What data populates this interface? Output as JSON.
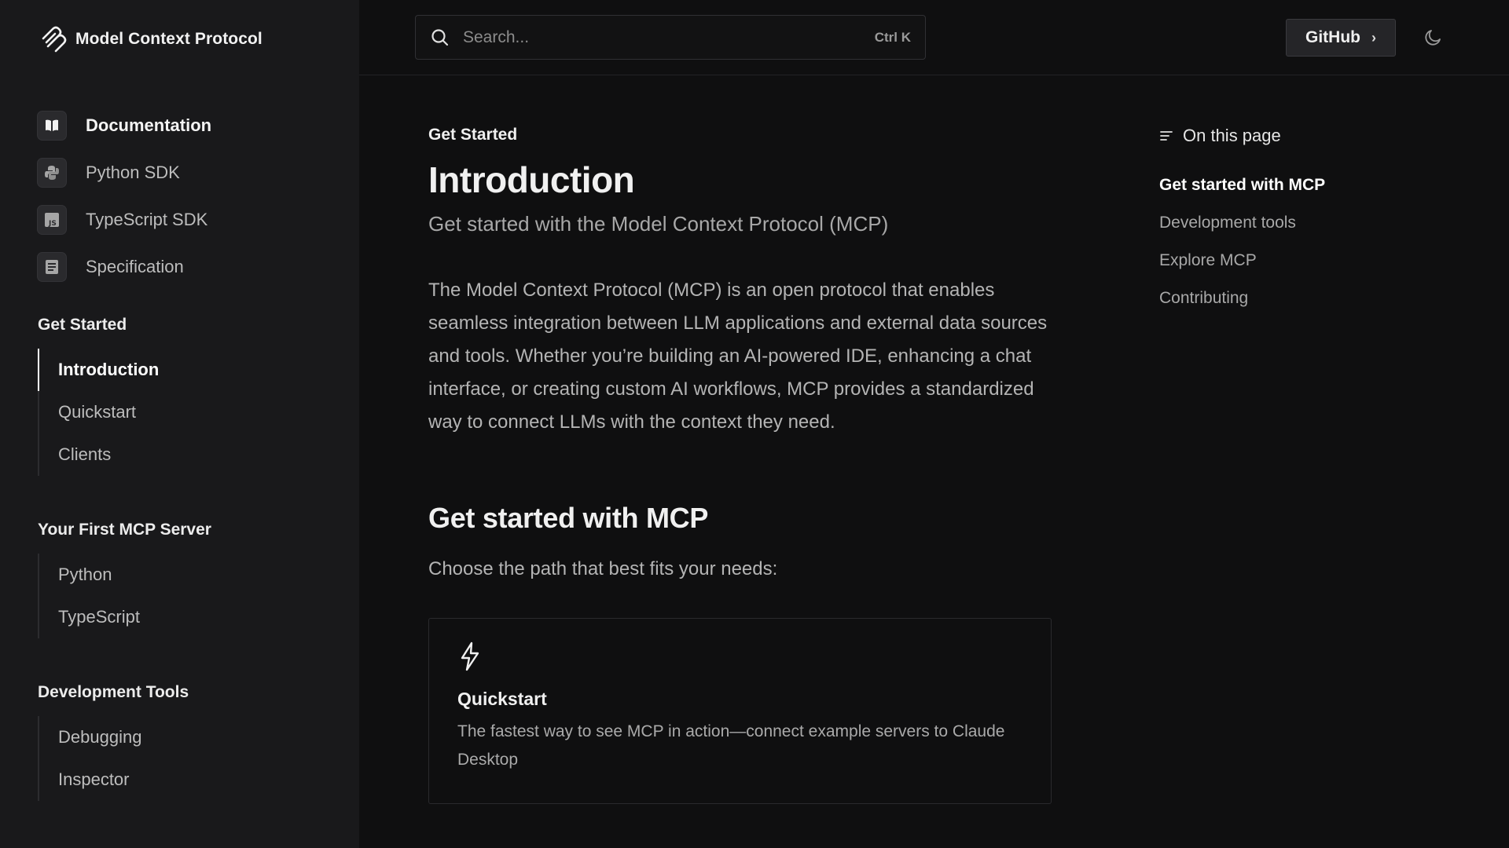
{
  "app": {
    "title": "Model Context Protocol"
  },
  "sidebar": {
    "top_links": [
      {
        "label": "Documentation",
        "icon": "book-icon"
      },
      {
        "label": "Python SDK",
        "icon": "python-icon"
      },
      {
        "label": "TypeScript SDK",
        "icon": "js-icon"
      },
      {
        "label": "Specification",
        "icon": "document-icon"
      }
    ],
    "groups": [
      {
        "title": "Get Started",
        "items": [
          "Introduction",
          "Quickstart",
          "Clients"
        ]
      },
      {
        "title": "Your First MCP Server",
        "items": [
          "Python",
          "TypeScript"
        ]
      },
      {
        "title": "Development Tools",
        "items": [
          "Debugging",
          "Inspector"
        ]
      }
    ]
  },
  "header": {
    "search_placeholder": "Search...",
    "search_shortcut": "Ctrl K",
    "github_label": "GitHub"
  },
  "main": {
    "eyebrow": "Get Started",
    "title": "Introduction",
    "subtitle": "Get started with the Model Context Protocol (MCP)",
    "intro": "The Model Context Protocol (MCP) is an open protocol that enables seamless integration between LLM applications and external data sources and tools. Whether you’re building an AI-powered IDE, enhancing a chat interface, or creating custom AI workflows, MCP provides a standardized way to connect LLMs with the context they need.",
    "section_title": "Get started with MCP",
    "section_lead": "Choose the path that best fits your needs:",
    "card": {
      "icon": "lightning-icon",
      "title": "Quickstart",
      "description": "The fastest way to see MCP in action—connect example servers to Claude Desktop"
    }
  },
  "toc": {
    "heading": "On this page",
    "items": [
      "Get started with MCP",
      "Development tools",
      "Explore MCP",
      "Contributing"
    ]
  }
}
